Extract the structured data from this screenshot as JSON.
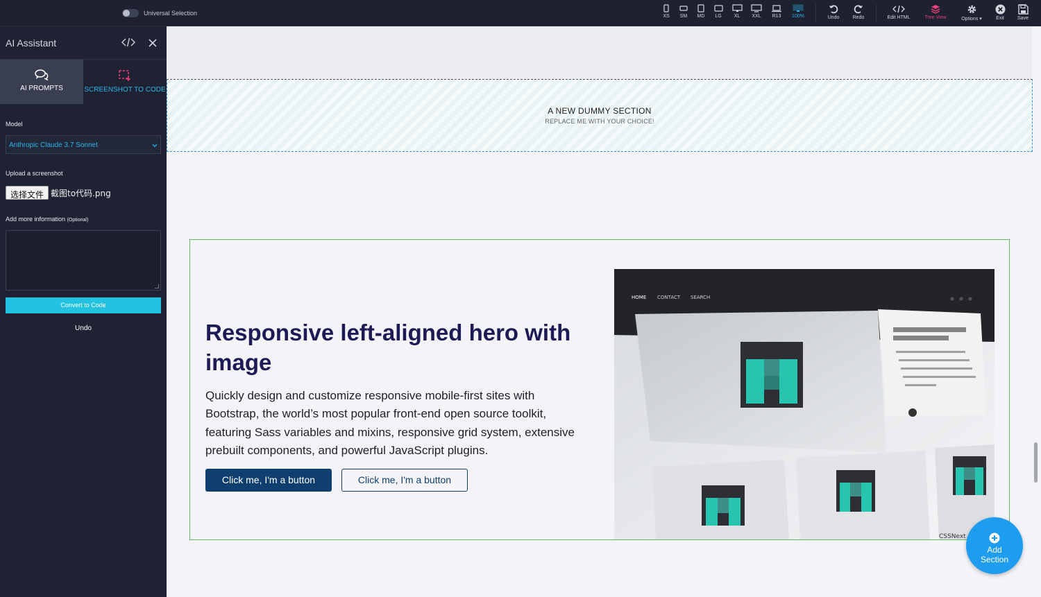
{
  "toolbar": {
    "universal_selection": "Universal Selection",
    "devices": [
      {
        "label": "XS",
        "icon": "phone-icon"
      },
      {
        "label": "SM",
        "icon": "phone-landscape-icon"
      },
      {
        "label": "MD",
        "icon": "tablet-icon"
      },
      {
        "label": "LG",
        "icon": "tablet-landscape-icon"
      },
      {
        "label": "XL",
        "icon": "desktop-icon"
      },
      {
        "label": "XXL",
        "icon": "monitor-icon"
      },
      {
        "label": "R13",
        "icon": "laptop-icon"
      },
      {
        "label": "100%",
        "icon": "fullscreen-monitor-icon"
      }
    ],
    "undo": "Undo",
    "redo": "Redo",
    "edit_html": "Edit HTML",
    "tree_view": "Tree View",
    "options": "Options ▾",
    "exit": "Exit",
    "save": "Save",
    "accent_color": "#2bb6e8",
    "tree_view_color": "#e8407a"
  },
  "panel": {
    "title": "AI Assistant",
    "tabs": {
      "prompts": "AI PROMPTS",
      "screenshot": "SCREENSHOT TO CODE"
    },
    "model_label": "Model",
    "model_value": "Anthropic Claude 3.7 Sonnet",
    "upload_label": "Upload a screenshot",
    "file_button": "选择文件",
    "file_name": "截图to代码.png",
    "info_label": "Add more information",
    "info_optional": "(Optional)",
    "convert_button": "Convert to Code",
    "undo": "Undo"
  },
  "canvas": {
    "dummy_title": "A NEW DUMMY SECTION",
    "dummy_subtitle": "REPLACE ME WITH YOUR CHOICE!",
    "hero_title": "Responsive left-aligned hero with image",
    "hero_text": "Quickly design and customize responsive mobile-first sites with Bootstrap, the world’s most popular front-end open source toolkit, featuring Sass variables and mixins, responsive grid system, extensive prebuilt components, and powerful JavaScript plugins.",
    "button_primary": "Click me, I'm a button",
    "button_secondary": "Click me, I'm a button",
    "image_nav": [
      "HOME",
      "CONTACT",
      "SEARCH"
    ],
    "image_caption": "CSSNext",
    "add_section": "Add Section",
    "primary_color": "#0e3f6e",
    "fab_color": "#1d9cf0"
  }
}
